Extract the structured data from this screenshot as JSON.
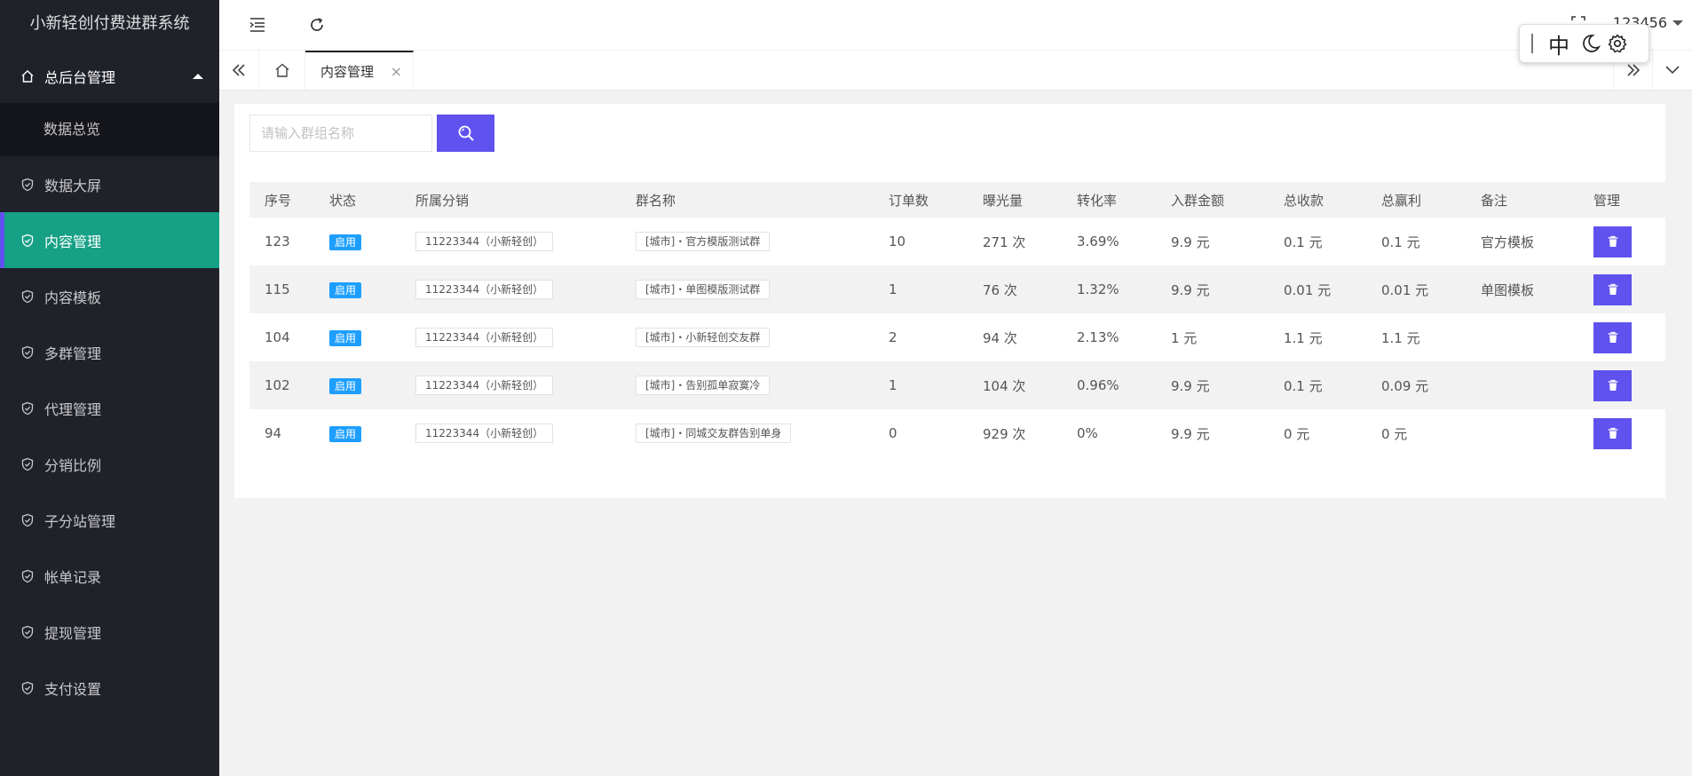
{
  "app": {
    "title": "小新轻创付费进群系统"
  },
  "sidebar": {
    "parent": {
      "label": "总后台管理",
      "icon": "home-icon"
    },
    "sub_items": [
      {
        "label": "数据总览"
      }
    ],
    "items": [
      {
        "label": "数据大屏",
        "icon": "shield-check-icon"
      },
      {
        "label": "内容管理",
        "icon": "shield-check-icon",
        "active": true
      },
      {
        "label": "内容模板",
        "icon": "shield-check-icon"
      },
      {
        "label": "多群管理",
        "icon": "shield-check-icon"
      },
      {
        "label": "代理管理",
        "icon": "shield-check-icon"
      },
      {
        "label": "分销比例",
        "icon": "shield-check-icon"
      },
      {
        "label": "子分站管理",
        "icon": "shield-check-icon"
      },
      {
        "label": "帐单记录",
        "icon": "shield-check-icon"
      },
      {
        "label": "提现管理",
        "icon": "shield-check-icon"
      },
      {
        "label": "支付设置",
        "icon": "shield-check-icon"
      }
    ]
  },
  "header": {
    "user": "123456"
  },
  "ime": {
    "lang": "中"
  },
  "tabs": [
    {
      "label": "内容管理",
      "close": "×"
    }
  ],
  "search": {
    "placeholder": "请输入群组名称"
  },
  "table": {
    "headers": [
      "序号",
      "状态",
      "所属分销",
      "群名称",
      "订单数",
      "曝光量",
      "转化率",
      "入群金额",
      "总收款",
      "总赢利",
      "备注",
      "管理"
    ],
    "rows": [
      {
        "id": "123",
        "status": "启用",
        "distributor": "11223344（小新轻创）",
        "group": "[城市]・官方模版测试群",
        "orders": "10",
        "exposure": "271 次",
        "rate": "3.69%",
        "price": "9.9 元",
        "income": "0.1 元",
        "profit": "0.1 元",
        "remark": "官方模板"
      },
      {
        "id": "115",
        "status": "启用",
        "distributor": "11223344（小新轻创）",
        "group": "[城市]・单图模版测试群",
        "orders": "1",
        "exposure": "76 次",
        "rate": "1.32%",
        "price": "9.9 元",
        "income": "0.01 元",
        "profit": "0.01 元",
        "remark": "单图模板"
      },
      {
        "id": "104",
        "status": "启用",
        "distributor": "11223344（小新轻创）",
        "group": "[城市]・小新轻创交友群",
        "orders": "2",
        "exposure": "94 次",
        "rate": "2.13%",
        "price": "1 元",
        "income": "1.1 元",
        "profit": "1.1 元",
        "remark": ""
      },
      {
        "id": "102",
        "status": "启用",
        "distributor": "11223344（小新轻创）",
        "group": "[城市]・告别孤单寂寞冷",
        "orders": "1",
        "exposure": "104 次",
        "rate": "0.96%",
        "price": "9.9 元",
        "income": "0.1 元",
        "profit": "0.09 元",
        "remark": ""
      },
      {
        "id": "94",
        "status": "启用",
        "distributor": "11223344（小新轻创）",
        "group": "[城市]・同城交友群告别单身",
        "orders": "0",
        "exposure": "929 次",
        "rate": "0%",
        "price": "9.9 元",
        "income": "0 元",
        "profit": "0 元",
        "remark": ""
      }
    ]
  },
  "colors": {
    "sidebar_bg": "#20222a",
    "active": "#16a085",
    "accent": "#5f52ee",
    "badge": "#1e9fff"
  }
}
